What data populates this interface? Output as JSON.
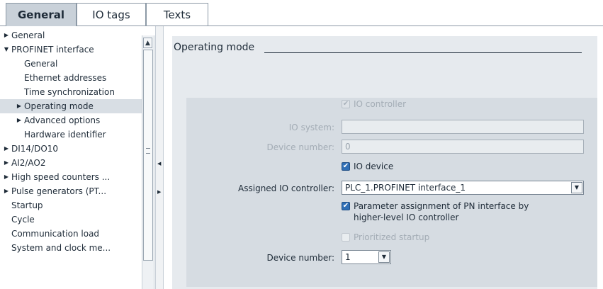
{
  "tabs": [
    {
      "label": "General"
    },
    {
      "label": "IO tags"
    },
    {
      "label": "Texts"
    }
  ],
  "tree": [
    {
      "label": "General",
      "arrow": "▶"
    },
    {
      "label": "PROFINET interface",
      "arrow": "▼"
    },
    {
      "label": "General",
      "arrow": ""
    },
    {
      "label": "Ethernet addresses",
      "arrow": ""
    },
    {
      "label": "Time synchronization",
      "arrow": ""
    },
    {
      "label": "Operating mode",
      "arrow": "▶"
    },
    {
      "label": "Advanced options",
      "arrow": "▶"
    },
    {
      "label": "Hardware identifier",
      "arrow": ""
    },
    {
      "label": "DI14/DO10",
      "arrow": "▶"
    },
    {
      "label": "AI2/AO2",
      "arrow": "▶"
    },
    {
      "label": "High speed counters ...",
      "arrow": "▶"
    },
    {
      "label": "Pulse generators (PT...",
      "arrow": "▶"
    },
    {
      "label": "Startup",
      "arrow": ""
    },
    {
      "label": "Cycle",
      "arrow": ""
    },
    {
      "label": "Communication load",
      "arrow": ""
    },
    {
      "label": "System and clock me...",
      "arrow": ""
    }
  ],
  "scrollbar": {
    "up_icon": "▲"
  },
  "splitter": {
    "left_icon": "◀",
    "right_icon": "▶"
  },
  "section": {
    "title": "Operating mode"
  },
  "form": {
    "io_controller_label": "IO controller",
    "io_controller_checked": true,
    "io_system_label": "IO system:",
    "io_system_value": "",
    "device_number_dim_label": "Device number:",
    "device_number_dim_value": "0",
    "io_device_label": "IO device",
    "io_device_checked": true,
    "assigned_io_controller_label": "Assigned IO controller:",
    "assigned_io_controller_value": "PLC_1.PROFINET interface_1",
    "param_assignment_label_line1": "Parameter assignment of PN interface by",
    "param_assignment_label_line2": "higher-level IO controller",
    "param_assignment_checked": true,
    "prioritized_startup_label": "Prioritized startup",
    "prioritized_startup_checked": false,
    "device_number_label": "Device number:",
    "device_number_value": "1",
    "checkmark_icon": "✔",
    "dropdown_icon": "▼"
  },
  "colors": {
    "active_tab": "#c9d1d9",
    "panel": "#e6eaee",
    "inner_panel": "#d6dce2",
    "checkbox_blue": "#2f6fb6",
    "text": "#1e2b38",
    "dim_text": "#a3acb5"
  }
}
